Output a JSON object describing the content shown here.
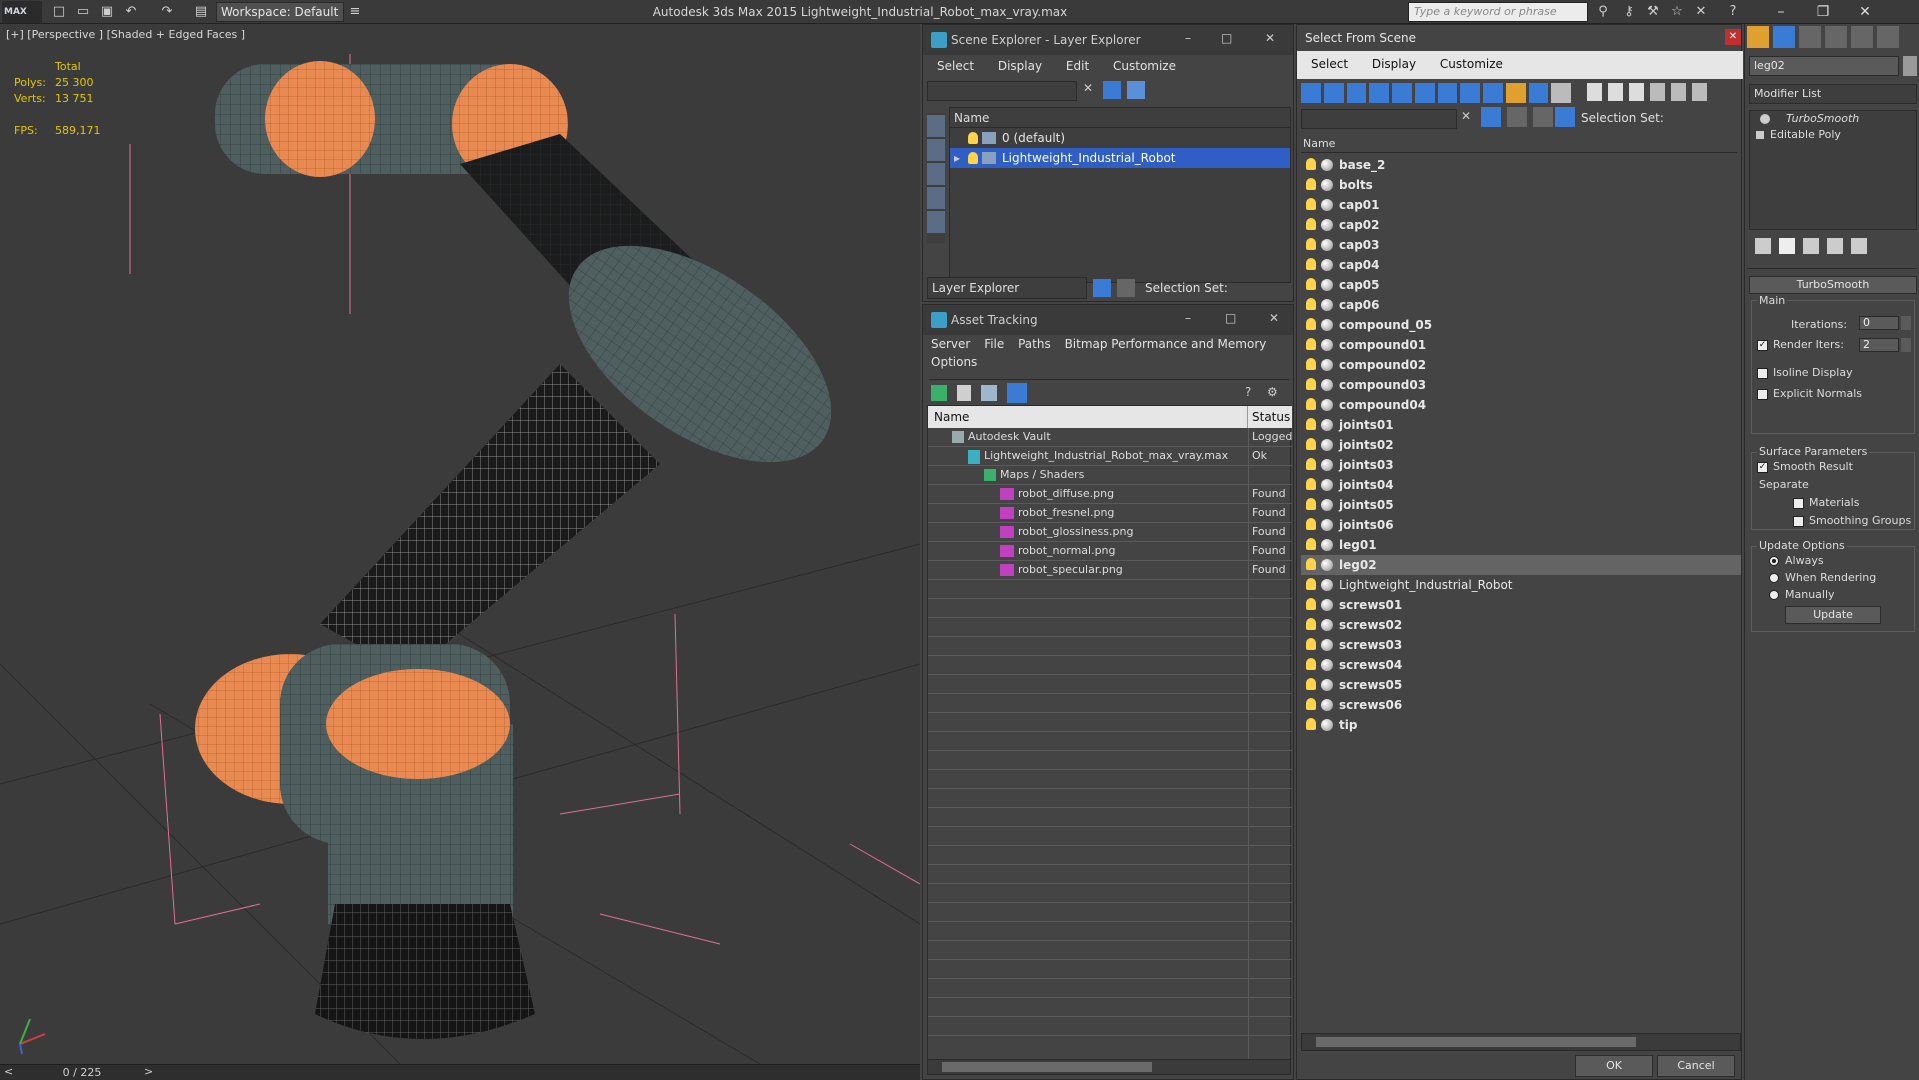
{
  "titlebar": {
    "logo": "MAX",
    "workspace": "Workspace: Default",
    "app_title": "Autodesk 3ds Max 2015 Lightweight_Industrial_Robot_max_vray.max",
    "search_placeholder": "Type a keyword or phrase"
  },
  "viewport": {
    "label": "[+] [Perspective ] [Shaded + Edged Faces ]",
    "stats": {
      "total_label": "Total",
      "polys_label": "Polys:",
      "polys_value": "25 300",
      "verts_label": "Verts:",
      "verts_value": "13 751",
      "fps_label": "FPS:",
      "fps_value": "589,171"
    }
  },
  "timeslider": {
    "frame": "0 / 225"
  },
  "scene_explorer": {
    "title": "Scene Explorer - Layer Explorer",
    "menu": [
      "Select",
      "Display",
      "Edit",
      "Customize"
    ],
    "col_name": "Name",
    "rows": [
      "0 (default)",
      "Lightweight_Industrial_Robot"
    ],
    "footer_dropdown": "Layer Explorer",
    "selection_set_label": "Selection Set:"
  },
  "asset_tracking": {
    "title": "Asset Tracking",
    "menu": [
      "Server",
      "File",
      "Paths",
      "Bitmap Performance and Memory",
      "Options"
    ],
    "col_name": "Name",
    "col_status": "Status",
    "rows": [
      {
        "name": "Autodesk Vault",
        "status": "Logged"
      },
      {
        "name": "Lightweight_Industrial_Robot_max_vray.max",
        "status": "Ok"
      },
      {
        "name": "Maps / Shaders",
        "status": ""
      },
      {
        "name": "robot_diffuse.png",
        "status": "Found"
      },
      {
        "name": "robot_fresnel.png",
        "status": "Found"
      },
      {
        "name": "robot_glossiness.png",
        "status": "Found"
      },
      {
        "name": "robot_normal.png",
        "status": "Found"
      },
      {
        "name": "robot_specular.png",
        "status": "Found"
      }
    ]
  },
  "select_from_scene": {
    "title": "Select From Scene",
    "menu": [
      "Select",
      "Display",
      "Customize"
    ],
    "selection_set_label": "Selection Set:",
    "col_name": "Name",
    "objects": [
      "base_2",
      "bolts",
      "cap01",
      "cap02",
      "cap03",
      "cap04",
      "cap05",
      "cap06",
      "compound_05",
      "compound01",
      "compound02",
      "compound03",
      "compound04",
      "joints01",
      "joints02",
      "joints03",
      "joints04",
      "joints05",
      "joints06",
      "leg01",
      "leg02",
      "Lightweight_Industrial_Robot",
      "screws01",
      "screws02",
      "screws03",
      "screws04",
      "screws05",
      "screws06",
      "tip"
    ],
    "selected": "leg02",
    "ok_label": "OK",
    "cancel_label": "Cancel"
  },
  "modifier_panel": {
    "object_name": "leg02",
    "modifier_list": "Modifier List",
    "stack": [
      "TurboSmooth",
      "Editable Poly"
    ],
    "rollout_title": "TurboSmooth",
    "main_label": "Main",
    "iterations_label": "Iterations:",
    "iterations_value": "0",
    "render_iters_label": "Render Iters:",
    "render_iters_value": "2",
    "isoline_label": "Isoline Display",
    "explicit_normals_label": "Explicit Normals",
    "surface_params_label": "Surface Parameters",
    "smooth_result_label": "Smooth Result",
    "separate_label": "Separate",
    "materials_label": "Materials",
    "smoothing_groups_label": "Smoothing Groups",
    "update_options_label": "Update Options",
    "always_label": "Always",
    "when_rendering_label": "When Rendering",
    "manually_label": "Manually",
    "update_button": "Update",
    "render_iters_checked": true,
    "smooth_result_checked": true
  },
  "colors": {
    "accent_selection": "#2f5fc4",
    "stats_yellow": "#e3c600",
    "robot_orange": "#e88a52",
    "robot_grey": "#4f5f5f"
  }
}
